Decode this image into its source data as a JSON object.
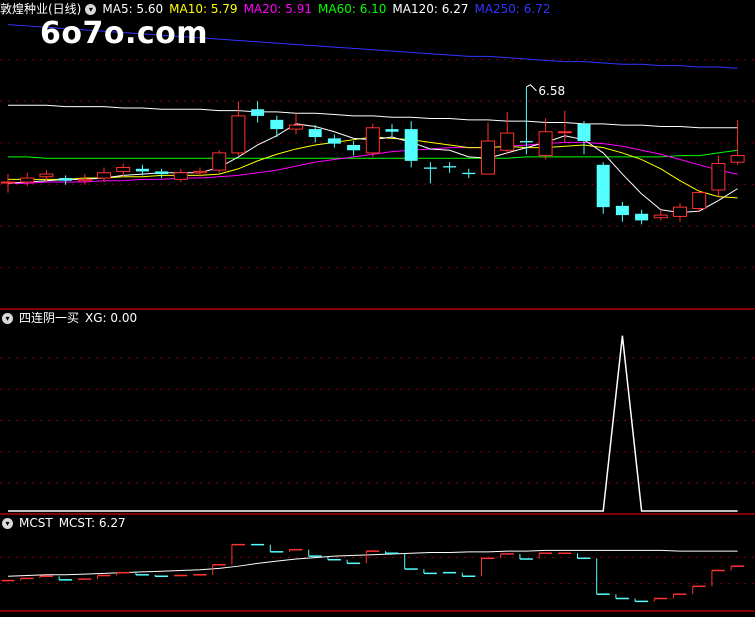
{
  "stock_name": "敦煌种业(日线)",
  "watermark": "6o7o.com",
  "price_panel": {
    "ma_labels": [
      {
        "text": "MA5: 5.60",
        "color": "#ffffff"
      },
      {
        "text": "MA10: 5.79",
        "color": "#ffff00"
      },
      {
        "text": "MA20: 5.91",
        "color": "#ff00ff"
      },
      {
        "text": "MA60: 6.10",
        "color": "#00ff00"
      },
      {
        "text": "MA120: 6.27",
        "color": "#ffffff"
      },
      {
        "text": "MA250: 6.72",
        "color": "#3333ff"
      }
    ],
    "high_marker": "6.58"
  },
  "indicator_panel": {
    "name": "四连阴一买",
    "value_label": "XG: 0.00"
  },
  "mcst_panel": {
    "name": "MCST",
    "value_label": "MCST: 6.27"
  },
  "colors": {
    "up": "#ff3232",
    "down": "#54ffff",
    "ma5": "#ffffff",
    "ma10": "#ffff00",
    "ma20": "#ff00ff",
    "ma60": "#00ff00",
    "ma120": "#ffffff",
    "ma250": "#3333ff",
    "grid": "#8b0000",
    "border": "#b00000"
  },
  "chart_data": {
    "type": "candlestick",
    "price_ylim": [
      4.9,
      7.1
    ],
    "candles": [
      {
        "o": 5.86,
        "c": 5.86,
        "h": 5.92,
        "l": 5.78
      },
      {
        "o": 5.86,
        "c": 5.89,
        "h": 5.93,
        "l": 5.83
      },
      {
        "o": 5.9,
        "c": 5.92,
        "h": 5.95,
        "l": 5.86
      },
      {
        "o": 5.89,
        "c": 5.87,
        "h": 5.91,
        "l": 5.84
      },
      {
        "o": 5.87,
        "c": 5.88,
        "h": 5.92,
        "l": 5.84
      },
      {
        "o": 5.89,
        "c": 5.93,
        "h": 5.97,
        "l": 5.86
      },
      {
        "o": 5.94,
        "c": 5.97,
        "h": 6.0,
        "l": 5.9
      },
      {
        "o": 5.96,
        "c": 5.94,
        "h": 5.99,
        "l": 5.91
      },
      {
        "o": 5.94,
        "c": 5.92,
        "h": 5.96,
        "l": 5.89
      },
      {
        "o": 5.88,
        "c": 5.93,
        "h": 5.96,
        "l": 5.86
      },
      {
        "o": 5.93,
        "c": 5.94,
        "h": 5.97,
        "l": 5.9
      },
      {
        "o": 5.95,
        "c": 6.08,
        "h": 6.1,
        "l": 5.93
      },
      {
        "o": 6.08,
        "c": 6.36,
        "h": 6.47,
        "l": 6.06
      },
      {
        "o": 6.41,
        "c": 6.36,
        "h": 6.47,
        "l": 6.31
      },
      {
        "o": 6.33,
        "c": 6.26,
        "h": 6.36,
        "l": 6.2
      },
      {
        "o": 6.26,
        "c": 6.29,
        "h": 6.38,
        "l": 6.22
      },
      {
        "o": 6.26,
        "c": 6.2,
        "h": 6.29,
        "l": 6.16
      },
      {
        "o": 6.19,
        "c": 6.15,
        "h": 6.22,
        "l": 6.12
      },
      {
        "o": 6.14,
        "c": 6.1,
        "h": 6.17,
        "l": 6.06
      },
      {
        "o": 6.08,
        "c": 6.27,
        "h": 6.3,
        "l": 6.05
      },
      {
        "o": 6.26,
        "c": 6.24,
        "h": 6.3,
        "l": 6.2
      },
      {
        "o": 6.26,
        "c": 6.02,
        "h": 6.32,
        "l": 5.97
      },
      {
        "o": 5.97,
        "c": 5.96,
        "h": 6.01,
        "l": 5.85
      },
      {
        "o": 5.98,
        "c": 5.97,
        "h": 6.01,
        "l": 5.93
      },
      {
        "o": 5.93,
        "c": 5.92,
        "h": 5.96,
        "l": 5.89
      },
      {
        "o": 5.92,
        "c": 6.17,
        "h": 6.31,
        "l": 5.92
      },
      {
        "o": 6.1,
        "c": 6.23,
        "h": 6.39,
        "l": 6.07
      },
      {
        "o": 6.17,
        "c": 6.16,
        "h": 6.58,
        "l": 6.07
      },
      {
        "o": 6.06,
        "c": 6.24,
        "h": 6.34,
        "l": 6.03
      },
      {
        "o": 6.24,
        "c": 6.24,
        "h": 6.4,
        "l": 6.16
      },
      {
        "o": 6.3,
        "c": 6.17,
        "h": 6.32,
        "l": 6.07
      },
      {
        "o": 5.99,
        "c": 5.67,
        "h": 6.01,
        "l": 5.62
      },
      {
        "o": 5.68,
        "c": 5.61,
        "h": 5.71,
        "l": 5.56
      },
      {
        "o": 5.62,
        "c": 5.57,
        "h": 5.65,
        "l": 5.54
      },
      {
        "o": 5.59,
        "c": 5.61,
        "h": 5.65,
        "l": 5.57
      },
      {
        "o": 5.6,
        "c": 5.67,
        "h": 5.7,
        "l": 5.56
      },
      {
        "o": 5.66,
        "c": 5.78,
        "h": 5.8,
        "l": 5.63
      },
      {
        "o": 5.8,
        "c": 6.0,
        "h": 6.06,
        "l": 5.75
      },
      {
        "o": 6.01,
        "c": 6.06,
        "h": 6.33,
        "l": 5.99
      }
    ],
    "ma5": [
      5.85,
      5.86,
      5.87,
      5.88,
      5.88,
      5.89,
      5.91,
      5.92,
      5.93,
      5.93,
      5.93,
      5.97,
      6.05,
      6.14,
      6.21,
      6.3,
      6.28,
      6.24,
      6.19,
      6.18,
      6.2,
      6.16,
      6.11,
      6.1,
      6.05,
      6.04,
      6.08,
      6.12,
      6.16,
      6.21,
      6.18,
      6.08,
      5.92,
      5.77,
      5.65,
      5.63,
      5.64,
      5.72,
      5.81
    ],
    "ma10": [
      5.88,
      5.88,
      5.88,
      5.88,
      5.89,
      5.89,
      5.9,
      5.9,
      5.91,
      5.91,
      5.91,
      5.92,
      5.96,
      6.02,
      6.07,
      6.11,
      6.14,
      6.16,
      6.18,
      6.2,
      6.19,
      6.18,
      6.16,
      6.14,
      6.12,
      6.12,
      6.13,
      6.12,
      6.12,
      6.13,
      6.14,
      6.12,
      6.08,
      6.03,
      5.96,
      5.87,
      5.79,
      5.75,
      5.74
    ],
    "ma20": [
      5.85,
      5.85,
      5.86,
      5.86,
      5.86,
      5.87,
      5.87,
      5.88,
      5.88,
      5.89,
      5.89,
      5.9,
      5.91,
      5.93,
      5.95,
      5.98,
      6.01,
      6.03,
      6.05,
      6.07,
      6.09,
      6.1,
      6.11,
      6.12,
      6.12,
      6.12,
      6.13,
      6.14,
      6.15,
      6.16,
      6.16,
      6.15,
      6.13,
      6.1,
      6.07,
      6.03,
      5.99,
      5.95,
      5.92
    ],
    "ma60": [
      6.05,
      6.05,
      6.04,
      6.04,
      6.04,
      6.04,
      6.04,
      6.04,
      6.04,
      6.04,
      6.04,
      6.04,
      6.04,
      6.04,
      6.04,
      6.04,
      6.04,
      6.04,
      6.04,
      6.04,
      6.04,
      6.04,
      6.04,
      6.04,
      6.04,
      6.04,
      6.04,
      6.05,
      6.05,
      6.05,
      6.05,
      6.05,
      6.05,
      6.05,
      6.05,
      6.06,
      6.06,
      6.08,
      6.1
    ],
    "ma120": [
      6.44,
      6.44,
      6.44,
      6.43,
      6.43,
      6.43,
      6.42,
      6.42,
      6.41,
      6.41,
      6.41,
      6.4,
      6.4,
      6.39,
      6.39,
      6.38,
      6.38,
      6.37,
      6.36,
      6.36,
      6.35,
      6.35,
      6.34,
      6.34,
      6.33,
      6.33,
      6.32,
      6.32,
      6.31,
      6.31,
      6.3,
      6.3,
      6.29,
      6.29,
      6.28,
      6.28,
      6.27,
      6.27,
      6.27
    ],
    "ma250": [
      7.05,
      7.04,
      7.03,
      7.02,
      7.01,
      7.0,
      6.99,
      6.98,
      6.97,
      6.96,
      6.95,
      6.94,
      6.93,
      6.92,
      6.91,
      6.9,
      6.89,
      6.88,
      6.87,
      6.86,
      6.85,
      6.84,
      6.83,
      6.82,
      6.81,
      6.81,
      6.8,
      6.79,
      6.78,
      6.77,
      6.77,
      6.76,
      6.75,
      6.75,
      6.74,
      6.74,
      6.73,
      6.73,
      6.72
    ],
    "xg_values": [
      0,
      0,
      0,
      0,
      0,
      0,
      0,
      0,
      0,
      0,
      0,
      0,
      0,
      0,
      0,
      0,
      0,
      0,
      0,
      0,
      0,
      0,
      0,
      0,
      0,
      0,
      0,
      0,
      0,
      0,
      0,
      0,
      1,
      0,
      0,
      0,
      0,
      0,
      0
    ],
    "xg_ylim": [
      0,
      1.05
    ],
    "mcst": [
      5.92,
      5.93,
      5.94,
      5.94,
      5.95,
      5.96,
      5.97,
      5.98,
      5.99,
      6.0,
      6.01,
      6.03,
      6.06,
      6.1,
      6.13,
      6.16,
      6.18,
      6.2,
      6.21,
      6.22,
      6.23,
      6.24,
      6.25,
      6.25,
      6.26,
      6.26,
      6.27,
      6.27,
      6.28,
      6.28,
      6.28,
      6.28,
      6.28,
      6.28,
      6.28,
      6.27,
      6.27,
      6.27,
      6.27
    ],
    "mcst_ylim": [
      5.45,
      6.55
    ]
  }
}
